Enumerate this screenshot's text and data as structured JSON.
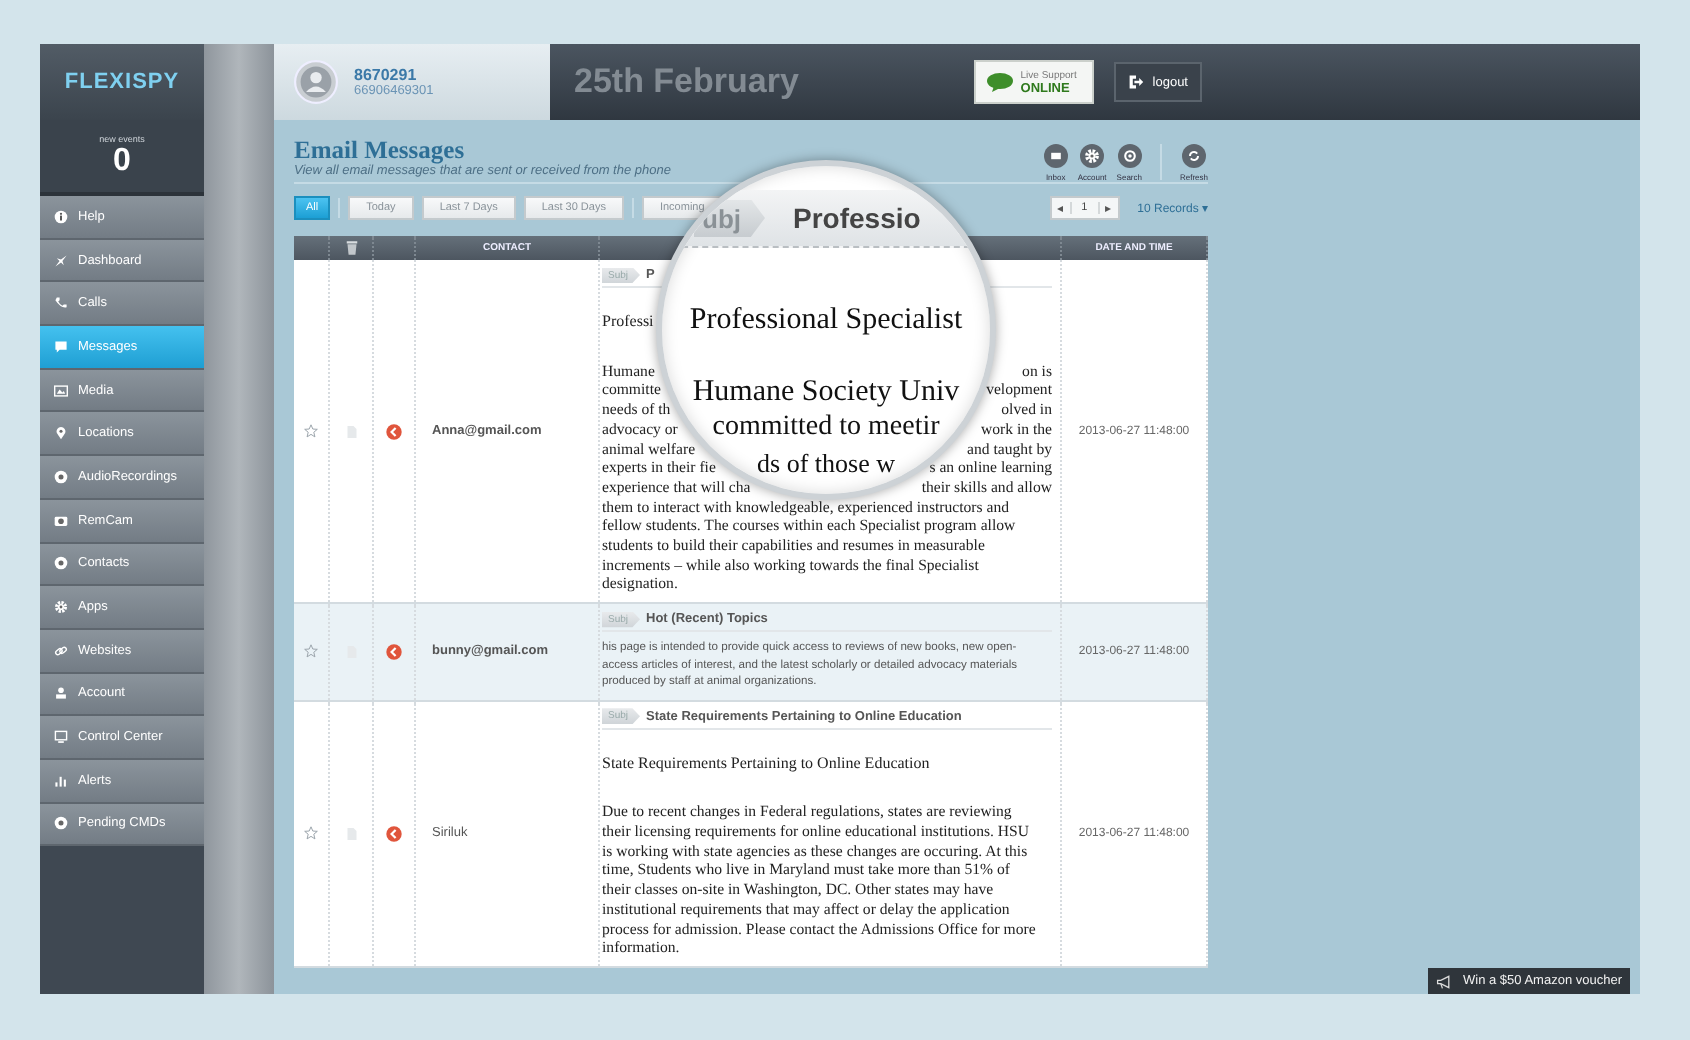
{
  "brand": {
    "logo": "FLEXISPY"
  },
  "events": {
    "label": "new events",
    "count": "0"
  },
  "sidebar": {
    "items": [
      {
        "label": "Help",
        "selected": false
      },
      {
        "label": "Dashboard",
        "selected": false
      },
      {
        "label": "Calls",
        "selected": false
      },
      {
        "label": "Messages",
        "selected": true
      },
      {
        "label": "Media",
        "selected": false
      },
      {
        "label": "Locations",
        "selected": false
      },
      {
        "label": "AudioRecordings",
        "selected": false
      },
      {
        "label": "RemCam",
        "selected": false
      },
      {
        "label": "Contacts",
        "selected": false
      },
      {
        "label": "Apps",
        "selected": false
      },
      {
        "label": "Websites",
        "selected": false
      },
      {
        "label": "Account",
        "selected": false
      },
      {
        "label": "Control Center",
        "selected": false
      },
      {
        "label": "Alerts",
        "selected": false
      },
      {
        "label": "Pending CMDs",
        "selected": false
      }
    ]
  },
  "header": {
    "phone": "8670291",
    "imei": "66906469301",
    "date": "25th February",
    "support": {
      "label": "Live Support",
      "status": "ONLINE"
    },
    "logout": "logout"
  },
  "page": {
    "title": "Email Messages",
    "subtitle": "View all email messages that are sent or received from the phone",
    "tools": [
      {
        "label": "Inbox"
      },
      {
        "label": "Account"
      },
      {
        "label": "Search"
      },
      {
        "label": "Refresh"
      }
    ]
  },
  "filters": [
    {
      "label": "All",
      "selected": true
    },
    {
      "label": "Today",
      "selected": false
    },
    {
      "label": "Last 7 Days",
      "selected": false
    },
    {
      "label": "Last 30 Days",
      "selected": false
    },
    {
      "label": "Incoming",
      "selected": false
    }
  ],
  "pager": {
    "prev": "◂",
    "page": "1",
    "next": "▸",
    "records": "10 Records ▾"
  },
  "table": {
    "columns": [
      {
        "kind": "blank"
      },
      {
        "kind": "trash"
      },
      {
        "kind": "blank"
      },
      {
        "kind": "text",
        "label": "CONTACT"
      },
      {
        "kind": "blank"
      },
      {
        "kind": "text",
        "label": "DATE AND TIME"
      }
    ],
    "rows": [
      {
        "starred": false,
        "selected": false,
        "unread": true,
        "contact": "Anna@gmail.com",
        "tag": "Subj",
        "subject": "P",
        "kind": "html",
        "title": "Professi",
        "lines": [
          {
            "left": "Humane",
            "right": "on is"
          },
          {
            "left": "committe",
            "right": "velopment"
          },
          {
            "left": "needs of th",
            "right": "olved in"
          },
          {
            "left": "advocacy or",
            "right": "work in the"
          },
          {
            "left": "animal welfare",
            "right": "and taught by"
          },
          {
            "left": "experts in their fie",
            "right": "s an online learning"
          },
          {
            "left": "experience that will cha",
            "right": "their skills and allow"
          },
          {
            "text": "them to interact with knowledgeable, experienced instructors and"
          },
          {
            "text": "fellow students. The courses within each Specialist program allow"
          },
          {
            "text": "students to build their capabilities and resumes in measurable"
          },
          {
            "text": "increments – while also working towards the final Specialist"
          },
          {
            "text": "designation."
          }
        ],
        "date": "2013-06-27 11:48:00"
      },
      {
        "starred": false,
        "selected": true,
        "unread": true,
        "contact": "bunny@gmail.com",
        "tag": "Subj",
        "subject": "Hot (Recent) Topics",
        "kind": "plain",
        "lines": [
          {
            "text": "his page is intended to provide quick access to reviews of new books, new open-access articles of interest, and the latest scholarly or detailed advocacy materials produced by staff at animal organizations."
          }
        ],
        "date": "2013-06-27 11:48:00"
      },
      {
        "starred": false,
        "selected": false,
        "unread": false,
        "contact": "Siriluk",
        "tag": "Subj",
        "subject": "State Requirements Pertaining to Online Education",
        "kind": "html",
        "title": "State Requirements Pertaining to Online Education",
        "lines": [
          {
            "text": "Due to recent changes in Federal regulations, states are reviewing"
          },
          {
            "text": "their licensing requirements for online educational institutions. HSU"
          },
          {
            "text": "is working with state agencies as these changes are occuring. At this"
          },
          {
            "text": "time, Students who live in Maryland must take more than 51% of"
          },
          {
            "text": "their classes on-site in Washington, DC. Other states may have"
          },
          {
            "text": "institutional requirements that may affect or delay the application"
          },
          {
            "text": "process for admission. Please contact the Admissions Office for more"
          },
          {
            "text": "information."
          }
        ],
        "date": "2013-06-27 11:48:00"
      }
    ]
  },
  "magnifier": {
    "tag": "ubj",
    "subject": "Professio",
    "title": "Professional Specialist",
    "lines": [
      "Humane Society Univ",
      "committed to meetir",
      "ds of those w"
    ]
  },
  "promo": {
    "text": "Win a $50 Amazon voucher"
  }
}
